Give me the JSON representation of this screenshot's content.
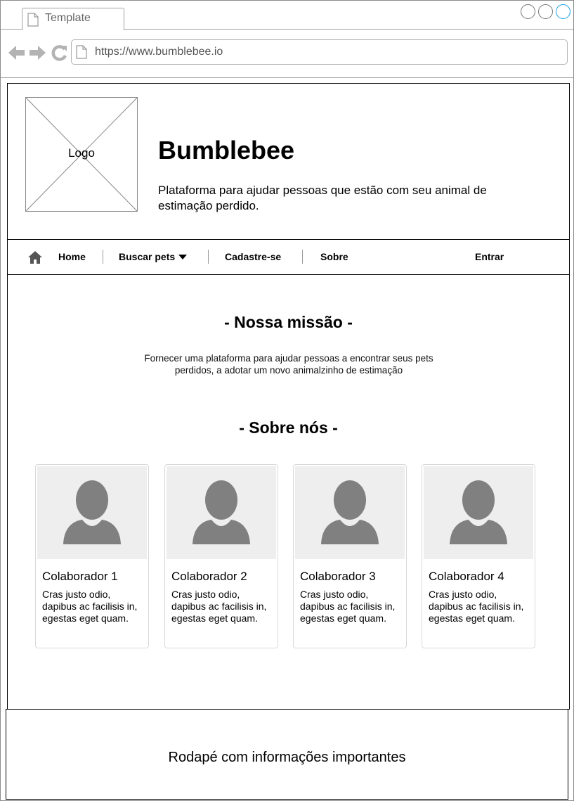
{
  "browser": {
    "tab_title": "Template",
    "url": "https://www.bumblebee.io",
    "icons": [
      "page-icon",
      "back-arrow-icon",
      "forward-arrow-icon",
      "reload-icon",
      "window-button-icon"
    ]
  },
  "header": {
    "logo_label": "Logo",
    "title": "Bumblebee",
    "description": "Plataforma para ajudar pessoas que estão com seu animal de estimação perdido."
  },
  "nav": {
    "home_icon": "home-icon",
    "home": "Home",
    "search_pets": "Buscar pets",
    "register": "Cadastre-se",
    "about": "Sobre",
    "login": "Entrar"
  },
  "mission": {
    "title": "- Nossa missão -",
    "text": "Fornecer uma plataforma para ajudar pessoas a encontrar seus pets perdidos, a adotar um novo animalzinho de estimação"
  },
  "about": {
    "title": "- Sobre nós -",
    "cards": [
      {
        "name": "Colaborador 1",
        "text": "Cras justo odio, dapibus ac facilisis in, egestas eget quam."
      },
      {
        "name": "Colaborador 2",
        "text": "Cras justo odio, dapibus ac facilisis in, egestas eget quam."
      },
      {
        "name": "Colaborador 3",
        "text": "Cras justo odio, dapibus ac facilisis in, egestas eget quam."
      },
      {
        "name": "Colaborador 4",
        "text": "Cras justo odio, dapibus ac facilisis in, egestas eget quam."
      }
    ]
  },
  "footer": {
    "text": "Rodapé com informações importantes"
  },
  "colors": {
    "chrome_border": "#a0a0a0",
    "icon_gray": "#b3b3b3",
    "avatar_gray": "#808080",
    "card_bg": "#eeeeee",
    "window_button_accent": "#1ba1e2"
  }
}
